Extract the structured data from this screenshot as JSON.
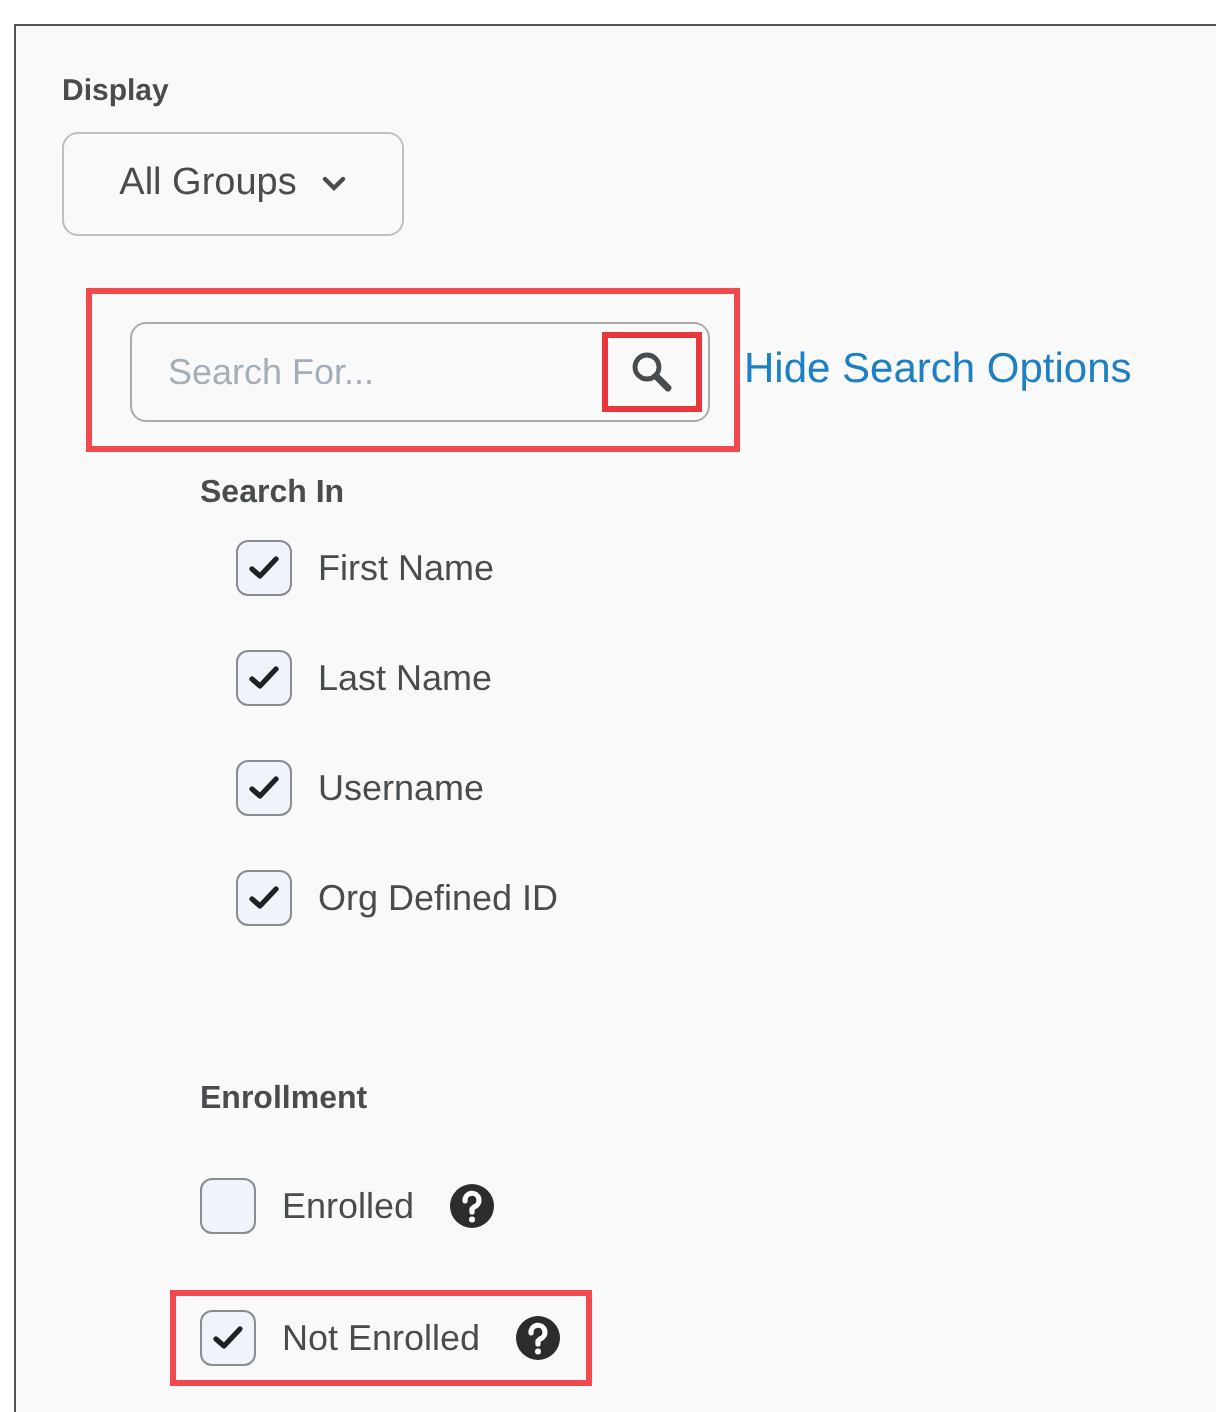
{
  "display": {
    "label": "Display",
    "dropdown": {
      "value": "All Groups"
    }
  },
  "search": {
    "placeholder": "Search For...",
    "highlighted": true,
    "button_highlighted": true,
    "link": "Hide Search Options"
  },
  "search_in": {
    "heading": "Search In",
    "options": [
      {
        "label": "First Name",
        "checked": true
      },
      {
        "label": "Last Name",
        "checked": true
      },
      {
        "label": "Username",
        "checked": true
      },
      {
        "label": "Org Defined ID",
        "checked": true
      }
    ]
  },
  "enrollment": {
    "heading": "Enrollment",
    "options": [
      {
        "label": "Enrolled",
        "checked": false,
        "highlighted": false
      },
      {
        "label": "Not Enrolled",
        "checked": true,
        "highlighted": true
      }
    ]
  }
}
